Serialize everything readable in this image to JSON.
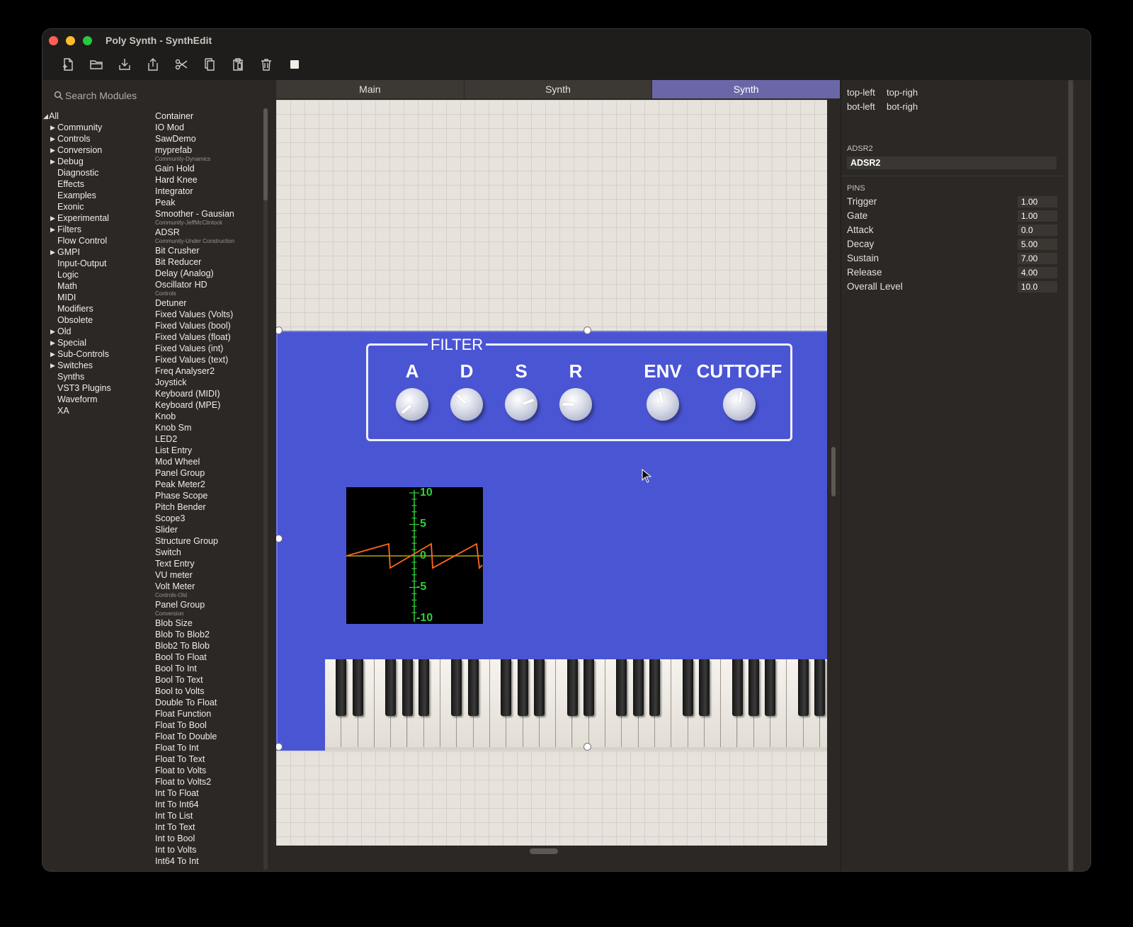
{
  "window": {
    "title": "Poly Synth - SynthEdit"
  },
  "colors": {
    "accent_tab": "#6a67a8",
    "panel_blue": "#4a55d4",
    "scope_trace": "#ff6a1a",
    "scope_axis": "#2fcf3a"
  },
  "toolbar": {
    "icons": [
      "new-file-icon",
      "open-folder-icon",
      "import-icon",
      "export-icon",
      "cut-icon",
      "copy-icon",
      "paste-icon",
      "trash-icon",
      "stop-icon"
    ]
  },
  "search": {
    "placeholder": "Search Modules"
  },
  "categories": [
    {
      "label": "All",
      "arrow": "◢",
      "top": true
    },
    {
      "label": "Community",
      "arrow": "▶"
    },
    {
      "label": "Controls",
      "arrow": "▶"
    },
    {
      "label": "Conversion",
      "arrow": "▶"
    },
    {
      "label": "Debug",
      "arrow": "▶"
    },
    {
      "label": "Diagnostic",
      "arrow": ""
    },
    {
      "label": "Effects",
      "arrow": ""
    },
    {
      "label": "Examples",
      "arrow": ""
    },
    {
      "label": "Exonic",
      "arrow": ""
    },
    {
      "label": "Experimental",
      "arrow": "▶"
    },
    {
      "label": "Filters",
      "arrow": "▶"
    },
    {
      "label": "Flow Control",
      "arrow": ""
    },
    {
      "label": "GMPI",
      "arrow": "▶"
    },
    {
      "label": "Input-Output",
      "arrow": ""
    },
    {
      "label": "Logic",
      "arrow": ""
    },
    {
      "label": "Math",
      "arrow": ""
    },
    {
      "label": "MIDI",
      "arrow": ""
    },
    {
      "label": "Modifiers",
      "arrow": ""
    },
    {
      "label": "Obsolete",
      "arrow": ""
    },
    {
      "label": "Old",
      "arrow": "▶"
    },
    {
      "label": "Special",
      "arrow": "▶"
    },
    {
      "label": "Sub-Controls",
      "arrow": "▶"
    },
    {
      "label": "Switches",
      "arrow": "▶"
    },
    {
      "label": "Synths",
      "arrow": ""
    },
    {
      "label": "VST3 Plugins",
      "arrow": ""
    },
    {
      "label": "Waveform",
      "arrow": ""
    },
    {
      "label": "XA",
      "arrow": ""
    }
  ],
  "modules": [
    {
      "t": "Container"
    },
    {
      "t": "IO Mod"
    },
    {
      "t": "SawDemo"
    },
    {
      "t": "myprefab"
    },
    {
      "t": "Community-Dynamics",
      "h": true
    },
    {
      "t": "Gain Hold"
    },
    {
      "t": "Hard Knee"
    },
    {
      "t": "Integrator"
    },
    {
      "t": "Peak"
    },
    {
      "t": "Smoother - Gausian"
    },
    {
      "t": "Community-JeffMcClintock",
      "h": true
    },
    {
      "t": "ADSR"
    },
    {
      "t": "Community-Under Construction",
      "h": true
    },
    {
      "t": "Bit Crusher"
    },
    {
      "t": "Bit Reducer"
    },
    {
      "t": "Delay (Analog)"
    },
    {
      "t": "Oscillator HD"
    },
    {
      "t": "Controls",
      "h": true
    },
    {
      "t": "Detuner"
    },
    {
      "t": "Fixed Values (Volts)"
    },
    {
      "t": "Fixed Values (bool)"
    },
    {
      "t": "Fixed Values (float)"
    },
    {
      "t": "Fixed Values (int)"
    },
    {
      "t": "Fixed Values (text)"
    },
    {
      "t": "Freq Analyser2"
    },
    {
      "t": "Joystick"
    },
    {
      "t": "Keyboard (MIDI)"
    },
    {
      "t": "Keyboard (MPE)"
    },
    {
      "t": "Knob"
    },
    {
      "t": "Knob Sm"
    },
    {
      "t": "LED2"
    },
    {
      "t": "List Entry"
    },
    {
      "t": "Mod Wheel"
    },
    {
      "t": "Panel Group"
    },
    {
      "t": "Peak Meter2"
    },
    {
      "t": "Phase Scope"
    },
    {
      "t": "Pitch Bender"
    },
    {
      "t": "Scope3"
    },
    {
      "t": "Slider"
    },
    {
      "t": "Structure Group"
    },
    {
      "t": "Switch"
    },
    {
      "t": "Text Entry"
    },
    {
      "t": "VU meter"
    },
    {
      "t": "Volt Meter"
    },
    {
      "t": "Controls-Old",
      "h": true
    },
    {
      "t": "Panel Group"
    },
    {
      "t": "Conversion",
      "h": true
    },
    {
      "t": "Blob Size"
    },
    {
      "t": "Blob To Blob2"
    },
    {
      "t": "Blob2 To Blob"
    },
    {
      "t": "Bool To Float"
    },
    {
      "t": "Bool To Int"
    },
    {
      "t": "Bool To Text"
    },
    {
      "t": "Bool to Volts"
    },
    {
      "t": "Double To Float"
    },
    {
      "t": "Float Function"
    },
    {
      "t": "Float To Bool"
    },
    {
      "t": "Float To Double"
    },
    {
      "t": "Float To Int"
    },
    {
      "t": "Float To Text"
    },
    {
      "t": "Float to Volts"
    },
    {
      "t": "Float to Volts2"
    },
    {
      "t": "Int To Float"
    },
    {
      "t": "Int To Int64"
    },
    {
      "t": "Int To List"
    },
    {
      "t": "Int To Text"
    },
    {
      "t": "Int to Bool"
    },
    {
      "t": "Int to Volts"
    },
    {
      "t": "Int64 To Int"
    }
  ],
  "tabs": [
    {
      "label": "Main"
    },
    {
      "label": "Synth"
    },
    {
      "label": "Synth",
      "active": true
    }
  ],
  "filter": {
    "title": "FILTER",
    "knobs": [
      {
        "label": "A",
        "angle": -130
      },
      {
        "label": "D",
        "angle": -45
      },
      {
        "label": "S",
        "angle": 70
      },
      {
        "label": "R",
        "angle": -90
      },
      {
        "label": "ENV",
        "angle": -15
      },
      {
        "label": "CUTTOFF",
        "angle": 10
      }
    ]
  },
  "scope": {
    "ticks": [
      "10",
      "5",
      "0",
      "-5",
      "-10"
    ]
  },
  "inspector": {
    "alignment": {
      "tl": "top-left",
      "tr": "top-righ",
      "bl": "bot-left",
      "br": "bot-righ"
    },
    "module_section": "ADSR2",
    "module_name": "ADSR2",
    "pins_title": "PINS",
    "pins": [
      {
        "name": "Trigger",
        "value": "1.00"
      },
      {
        "name": "Gate",
        "value": "1.00"
      },
      {
        "name": "Attack",
        "value": "0.0"
      },
      {
        "name": "Decay",
        "value": "5.00"
      },
      {
        "name": "Sustain",
        "value": "7.00"
      },
      {
        "name": "Release",
        "value": "4.00"
      },
      {
        "name": "Overall Level",
        "value": "10.0"
      }
    ]
  }
}
